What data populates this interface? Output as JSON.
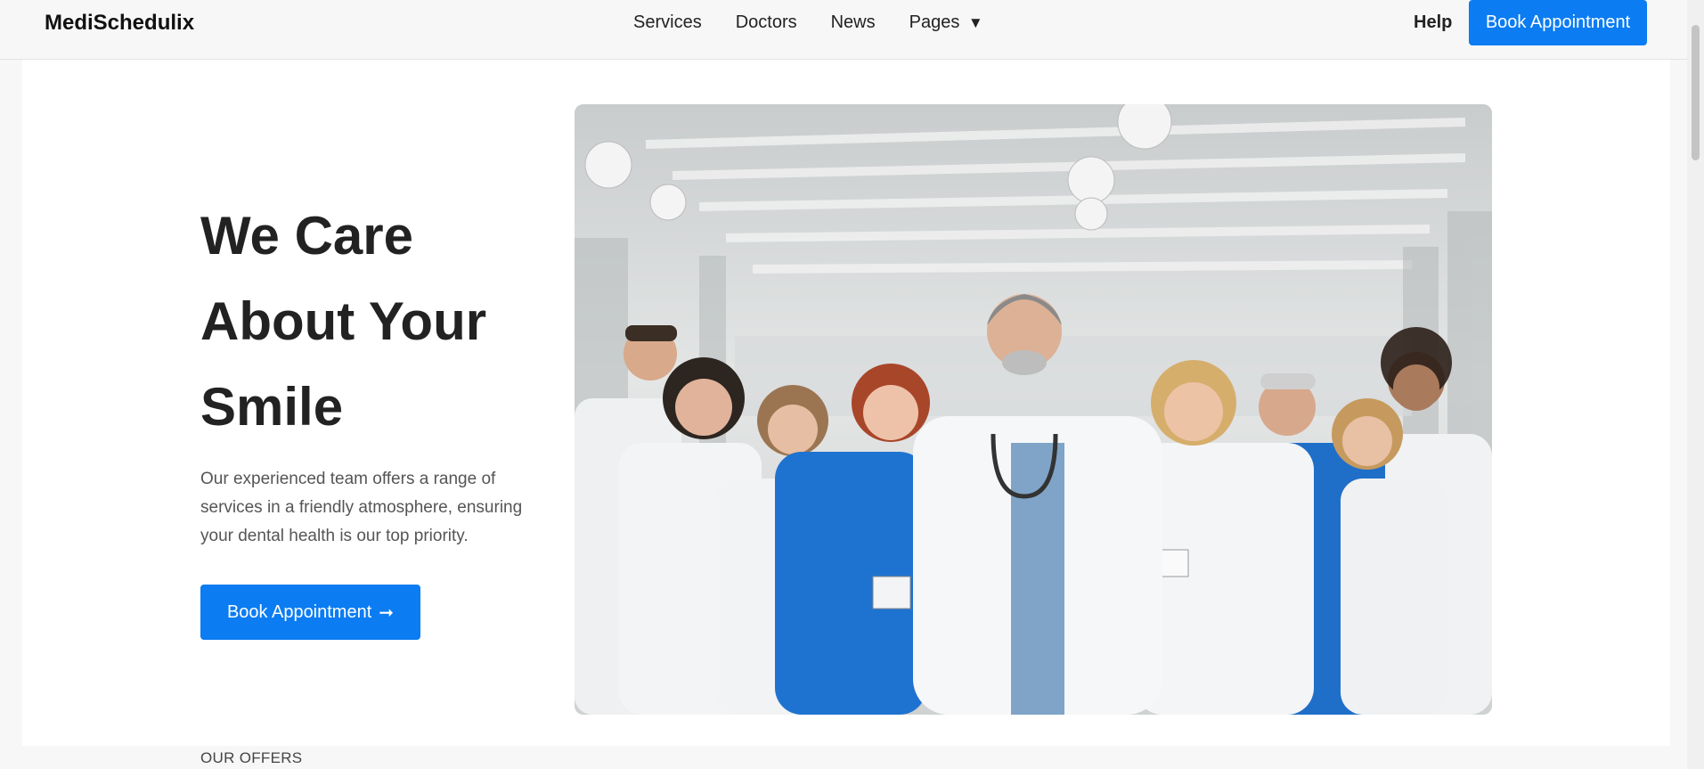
{
  "header": {
    "brand": "MediSchedulix",
    "nav": [
      {
        "label": "Services"
      },
      {
        "label": "Doctors"
      },
      {
        "label": "News"
      },
      {
        "label": "Pages",
        "caret": "▼"
      }
    ],
    "help": "Help",
    "cta": "Book Appointment"
  },
  "hero": {
    "title": "We Care About Your Smile",
    "text": "Our experienced team offers a range of services in a friendly atmosphere, ensuring your dental health is our top priority.",
    "cta": "Book Appointment",
    "cta_arrow": "➞",
    "image_alt": "Team of smiling medical staff in white coats and blue scrubs standing in a glass corridor"
  },
  "offers": {
    "label": "OUR OFFERS"
  },
  "colors": {
    "accent": "#0b7cf2",
    "background": "#f7f7f7",
    "surface": "#ffffff",
    "text_heading": "#222222",
    "text_body": "#555555"
  }
}
